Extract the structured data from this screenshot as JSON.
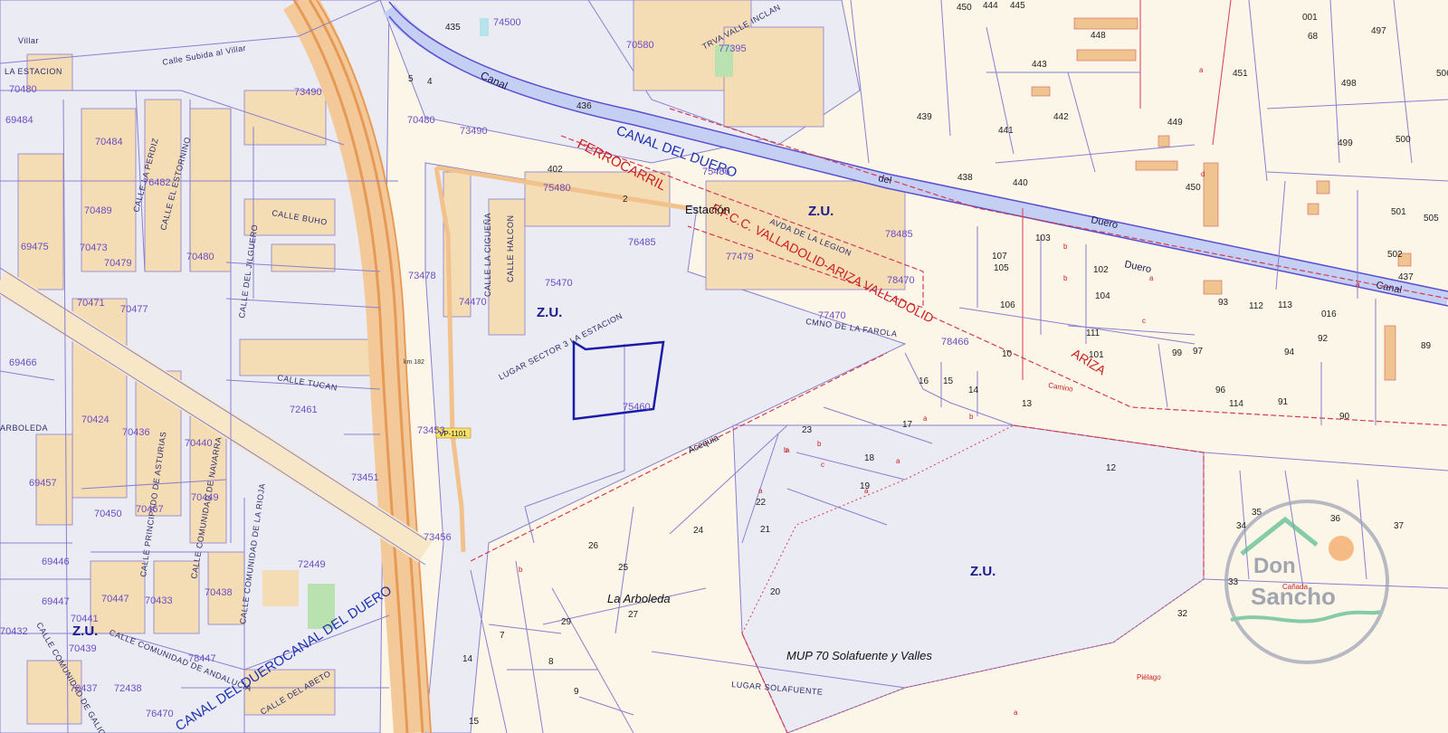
{
  "map": {
    "zones": {
      "zu_1": "Z.U.",
      "zu_2": "Z.U.",
      "zu_3": "Z.U.",
      "zu_4": "Z.U."
    },
    "features": {
      "canal_duero": "CANAL DEL DUERO",
      "canal_duero_sw": "CANAL DEL DUEROCANAL DEL DUERO",
      "canal_top": "Canal",
      "canal_east": "Canal",
      "del": "del",
      "duero_1": "Duero",
      "duero_2": "Duero",
      "ferrocarril": "FERROCARRIL",
      "ffcc": "F.F.C.C. VALLADOLID-ARIZA VALLADOLID",
      "ariza": "ARIZA",
      "estacion": "Estación",
      "acequia": "Acequia",
      "la_arboleda": "La Arboleda",
      "mup": "MUP 70 Solafuente y Valles",
      "km": "km 182",
      "road_sign": "VP-1101",
      "camino": "Camino",
      "canada": "Cañada",
      "pielago": "Piélago"
    },
    "streets": {
      "villar": "Calle Subida al Villar",
      "estacion_top": "LA ESTACION",
      "perdiz": "CALLE LA PERDIZ",
      "estornino": "CALLE EL ESTORNINO",
      "buho": "CALLE BUHO",
      "jilguero": "CALLE DEL JILGUERO",
      "halcon": "CALLE HALCON",
      "ciguena": "CALLE LA CIGUEÑA",
      "tucan": "CALLE TUCAN",
      "lugar_sector": "LUGAR SECTOR 3 LA ESTACION",
      "legion": "AVDA DE LA LEGION",
      "farola": "CMNO DE LA FAROLA",
      "valle_inclan": "TRVA VALLE INCLAN",
      "principado": "CALLE PRINCIPADO DE ASTURIAS",
      "navarra": "CALLE COMUNIDAD DE NAVARRA",
      "rioja": "CALLE COMUNIDAD DE LA RIOJA",
      "andalucia": "CALLE COMUNIDAD DE ANDALUCIA",
      "abeto": "CALLE DEL ABETO",
      "solafuente": "LUGAR SOLAFUENTE",
      "arboleda_w": "ARBOLEDA",
      "villar_left": "Villar",
      "galicia": "CALLE COMUNIDAD DE GALICIA"
    },
    "refs": [
      "74500",
      "70580",
      "77395",
      "70480",
      "73490",
      "69484",
      "70484",
      "70480",
      "73490",
      "75480",
      "75486",
      "76482",
      "70489",
      "69475",
      "70473",
      "70479",
      "70480",
      "73478",
      "75470",
      "74470",
      "70471",
      "70477",
      "76485",
      "77479",
      "78485",
      "78470",
      "77470",
      "78466",
      "69466",
      "72461",
      "70424",
      "70436",
      "70440",
      "73453",
      "75460",
      "69457",
      "70450",
      "70467",
      "70449",
      "69446",
      "72449",
      "73451",
      "73456",
      "69447",
      "70441",
      "70439",
      "70447",
      "70433",
      "70438",
      "70432",
      "70437",
      "72438",
      "78447",
      "76470"
    ],
    "parcels": [
      "435",
      "450",
      "444",
      "445",
      "448",
      "443",
      "451",
      "439",
      "441",
      "442",
      "449",
      "436",
      "402",
      "438",
      "440",
      "450",
      "2",
      "103",
      "105",
      "102",
      "107",
      "106",
      "104",
      "93",
      "112",
      "113",
      "016",
      "89",
      "111",
      "101",
      "99",
      "97",
      "92",
      "94",
      "96",
      "114",
      "91",
      "90",
      "10",
      "16",
      "15",
      "14",
      "13",
      "17",
      "12",
      "23",
      "18",
      "19",
      "22",
      "21",
      "24",
      "26",
      "25",
      "20",
      "29",
      "27",
      "14",
      "7",
      "8",
      "9",
      "15",
      "35",
      "36",
      "37",
      "34",
      "33",
      "32",
      "501",
      "502",
      "437",
      "505",
      "497",
      "498",
      "499",
      "500",
      "506",
      "68",
      "001",
      "5",
      "4"
    ],
    "subparcels": [
      "a",
      "b",
      "c",
      "d"
    ],
    "colors": {
      "background": "#fbf6e8",
      "parcel_line": "#8a7fd0",
      "boundary_red": "#d63a55",
      "highway": "#efb27a",
      "canal": "#a9b8f0",
      "highlight": "#1a1aa8",
      "urban_block": "#f3d3a6",
      "zone_grey": "#e8e8ee"
    },
    "logo": {
      "line1": "Don",
      "line2": "Sancho"
    }
  }
}
